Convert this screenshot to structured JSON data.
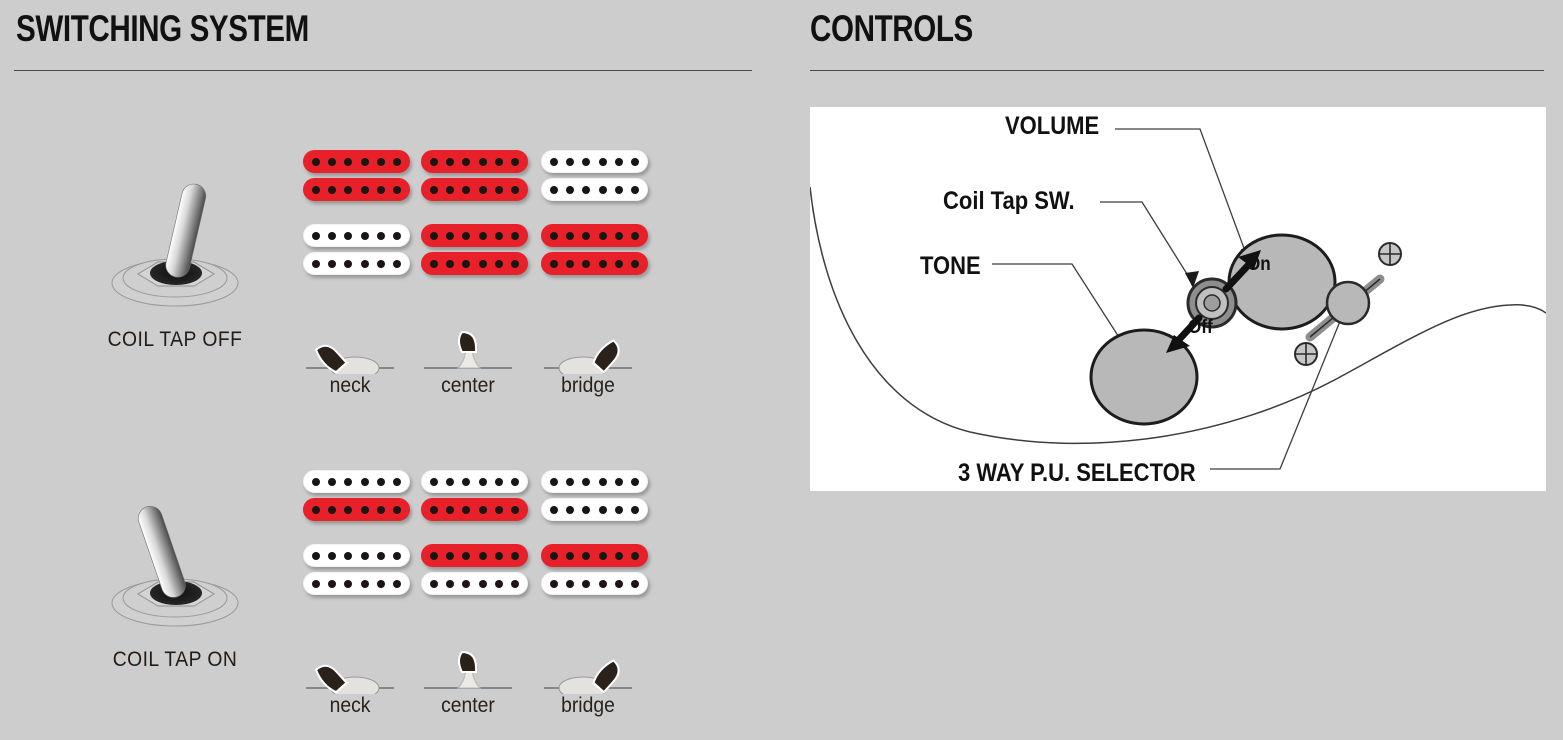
{
  "page": {
    "background_color": "#cdcdcd",
    "accent_red": "#e8202a",
    "panel_white": "#ffffff"
  },
  "left": {
    "title": "SWITCHING SYSTEM",
    "groups": [
      {
        "id": "coil-tap-off",
        "caption": "COIL TAP OFF",
        "toggle_state": "off",
        "toggle_lean": "right",
        "positions": [
          {
            "label": "neck",
            "switch_lean": "left",
            "neck_pickup": {
              "top_coil": "red",
              "bottom_coil": "red"
            },
            "bridge_pickup": {
              "top_coil": "white",
              "bottom_coil": "white"
            }
          },
          {
            "label": "center",
            "switch_lean": "center",
            "neck_pickup": {
              "top_coil": "red",
              "bottom_coil": "red"
            },
            "bridge_pickup": {
              "top_coil": "red",
              "bottom_coil": "red"
            }
          },
          {
            "label": "bridge",
            "switch_lean": "right",
            "neck_pickup": {
              "top_coil": "white",
              "bottom_coil": "white"
            },
            "bridge_pickup": {
              "top_coil": "red",
              "bottom_coil": "red"
            }
          }
        ]
      },
      {
        "id": "coil-tap-on",
        "caption": "COIL TAP ON",
        "toggle_state": "on",
        "toggle_lean": "left",
        "positions": [
          {
            "label": "neck",
            "switch_lean": "left",
            "neck_pickup": {
              "top_coil": "white",
              "bottom_coil": "red"
            },
            "bridge_pickup": {
              "top_coil": "white",
              "bottom_coil": "white"
            }
          },
          {
            "label": "center",
            "switch_lean": "center",
            "neck_pickup": {
              "top_coil": "white",
              "bottom_coil": "red"
            },
            "bridge_pickup": {
              "top_coil": "red",
              "bottom_coil": "white"
            }
          },
          {
            "label": "bridge",
            "switch_lean": "right",
            "neck_pickup": {
              "top_coil": "white",
              "bottom_coil": "white"
            },
            "bridge_pickup": {
              "top_coil": "red",
              "bottom_coil": "white"
            }
          }
        ]
      }
    ],
    "poles_per_coil": 6
  },
  "right": {
    "title": "CONTROLS",
    "figure": {
      "labels": {
        "volume": "VOLUME",
        "coil_tap_sw": "Coil Tap SW.",
        "tone": "TONE",
        "on": "On",
        "off": "Off",
        "selector": "3 WAY P.U. SELECTOR"
      },
      "knob_color": "#b8b8b8"
    }
  }
}
